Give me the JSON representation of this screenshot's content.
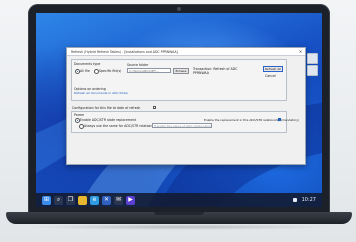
{
  "dialog": {
    "title": "Refresh (Hybrid Refresh Tables) - [Installations and ADC PPRNWAA]",
    "close_glyph": "✕",
    "source_group": {
      "label": "Documents type",
      "radio_all": "All file",
      "radio_specific": "Specific file(s)",
      "file_label": "Source folder",
      "file_placeholder": "C:\\Temp\\ABC\\DEF\\...",
      "browse_label": "Browse",
      "link_text": "Refresh all documents in ADC folder",
      "side_note": "Transaction: Refresh of ADC PPRNWAA",
      "refresh_button": "Refresh All",
      "cancel_button": "Cancel"
    },
    "options_label": "Options on ordering",
    "options_value": "Refresh the relationship of this file to ADC",
    "config_label": "Configuration for this file at date of refresh",
    "param_group": {
      "label": "Param",
      "check_1": "Enable ADC/STR state replacement",
      "check_2": "Always use the same for ADC/STR relationships",
      "check_2_hint": "Transfer the value of ADC relationships",
      "right_option": "Enable the replacement in this ADC/STR relationship (mandatory)"
    }
  },
  "taskbar": {
    "icons": [
      "windows-icon",
      "search-icon",
      "task-view-icon",
      "folder-icon",
      "edge-icon",
      "store-icon",
      "mail-icon",
      "media-icon"
    ],
    "tray_time": "10:27"
  },
  "colors": {
    "wallpaper_primary": "#1650c4",
    "accent": "#1a5fbf",
    "taskbar": "#121a30"
  }
}
